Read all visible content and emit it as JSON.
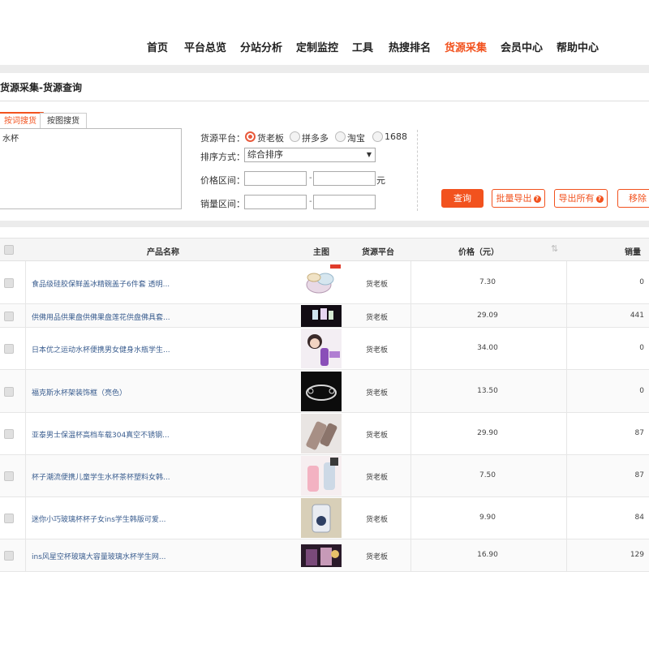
{
  "nav": {
    "items": [
      {
        "label": "首页",
        "active": false
      },
      {
        "label": "平台总览",
        "active": false
      },
      {
        "label": "分站分析",
        "active": false
      },
      {
        "label": "定制监控",
        "active": false
      },
      {
        "label": "工具",
        "active": false
      },
      {
        "label": "热搜排名",
        "active": false
      },
      {
        "label": "货源采集",
        "active": true
      },
      {
        "label": "会员中心",
        "active": false
      },
      {
        "label": "帮助中心",
        "active": false
      }
    ]
  },
  "page": {
    "title": "货源采集-货源查询"
  },
  "search": {
    "tabs": [
      "按词搜货",
      "按图搜货"
    ],
    "keyword_value": "水杯",
    "platform_label": "货源平台：",
    "platforms": [
      {
        "label": "货老板",
        "checked": true
      },
      {
        "label": "拼多多",
        "checked": false
      },
      {
        "label": "淘宝",
        "checked": false
      },
      {
        "label": "1688",
        "checked": false
      }
    ],
    "sort_label": "排序方式：",
    "sort_value": "综合排序",
    "price_label": "价格区间：",
    "price_unit": "元",
    "sales_label": "销量区间：",
    "range_sep": "-"
  },
  "buttons": {
    "query": "查询",
    "batch_export": "批量导出",
    "export_all": "导出所有",
    "remove": "移除"
  },
  "table": {
    "headers": {
      "name": "产品名称",
      "image": "主图",
      "platform": "货源平台",
      "price": "价格（元）",
      "sales": "销量"
    },
    "rows": [
      {
        "name": "食品级硅胶保鲜盖冰精碗盖子6件套 透明...",
        "platform": "货老板",
        "price": "7.30",
        "sales": "0",
        "thumb": "lids"
      },
      {
        "name": "供佛用品供果盘供佛果盘莲花供盘佛具套...",
        "platform": "货老板",
        "price": "29.09",
        "sales": "441",
        "thumb": "cups"
      },
      {
        "name": "日本优之运动水杯便携男女健身水瓶学生...",
        "platform": "货老板",
        "price": "34.00",
        "sales": "0",
        "thumb": "girl"
      },
      {
        "name": "福克斯水杯架装饰框（亮色）",
        "platform": "货老板",
        "price": "13.50",
        "sales": "0",
        "thumb": "ring"
      },
      {
        "name": "亚泰男士保温杯高档车载304真空不锈钢...",
        "platform": "货老板",
        "price": "29.90",
        "sales": "87",
        "thumb": "steel"
      },
      {
        "name": "杯子潮流便携儿童学生水杯茶杯塑料女韩...",
        "platform": "货老板",
        "price": "7.50",
        "sales": "87",
        "thumb": "pink"
      },
      {
        "name": "迷你小巧玻璃杯杯子女ins学生韩版可爱...",
        "platform": "货老板",
        "price": "9.90",
        "sales": "84",
        "thumb": "glass"
      },
      {
        "name": "ins风星空杯玻璃大容量玻璃水杯学生网...",
        "platform": "货老板",
        "price": "16.90",
        "sales": "129",
        "thumb": "star"
      }
    ]
  }
}
